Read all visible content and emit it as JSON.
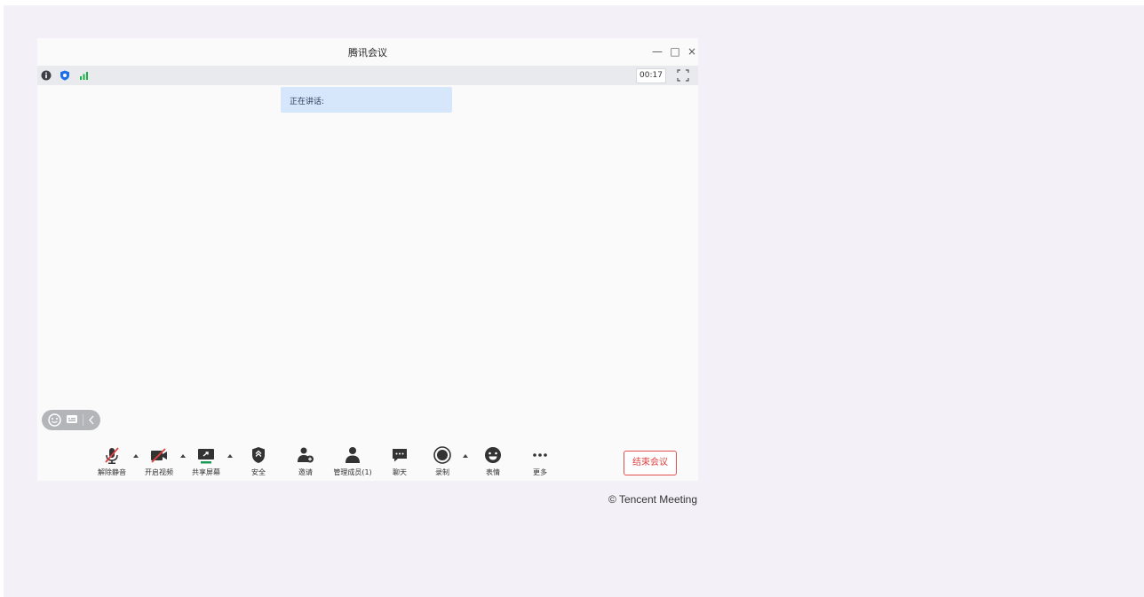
{
  "window": {
    "title": "腾讯会议"
  },
  "status": {
    "timer": "00:17"
  },
  "speaking": {
    "label": "正在讲话:"
  },
  "toolbar": {
    "mute_label": "解除静音",
    "video_label": "开启视频",
    "share_label": "共享屏幕",
    "security_label": "安全",
    "invite_label": "邀请",
    "members_label": "管理成员(1)",
    "chat_label": "聊天",
    "record_label": "录制",
    "emoji_label": "表情",
    "more_label": "更多",
    "end_label": "结束会议"
  },
  "footer": {
    "copyright": "© Tencent Meeting"
  },
  "colors": {
    "background": "#f4f0f7",
    "window": "#fafafa",
    "statusbar": "#e8eaee",
    "speaking_bg": "#d6e6fb",
    "accent_blue": "#1f6fe8",
    "signal_green": "#1ab34a",
    "end_red": "#e04040",
    "share_green": "#1a9a55"
  },
  "icons": [
    "info-icon",
    "shield-icon",
    "signal-icon",
    "fullscreen-icon",
    "mic-muted-icon",
    "video-off-icon",
    "share-screen-icon",
    "security-icon",
    "invite-icon",
    "members-icon",
    "chat-icon",
    "record-icon",
    "emoji-icon",
    "more-icon"
  ]
}
